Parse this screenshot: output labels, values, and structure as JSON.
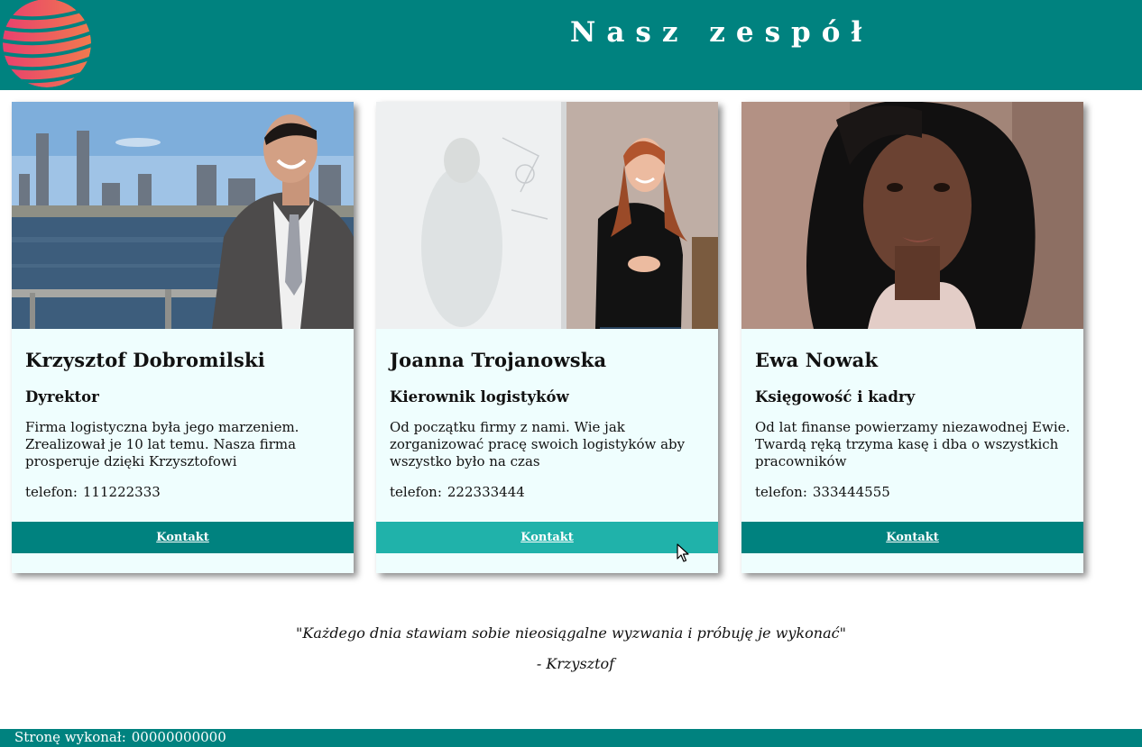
{
  "header": {
    "title": "Nasz zespół",
    "logo_icon": "globe-logo-icon",
    "background": "#00827f"
  },
  "team": [
    {
      "name": "Krzysztof Dobromilski",
      "role": "Dyrektor",
      "description": "Firma logistyczna była jego marzeniem. Zrealizował je 10 lat temu. Nasza firma prosperuje dzięki Krzysztofowi",
      "phone_label": "telefon:",
      "phone": "111222333",
      "button": "Kontakt",
      "photo": "man-in-suit-by-waterfront-photo"
    },
    {
      "name": "Joanna Trojanowska",
      "role": "Kierownik logistyków",
      "description": "Od początku firmy z nami. Wie jak zorganizować pracę swoich logistyków aby wszystko było na czas",
      "phone_label": "telefon:",
      "phone": "222333444",
      "button": "Kontakt",
      "photo": "woman-at-whiteboard-photo"
    },
    {
      "name": "Ewa Nowak",
      "role": "Księgowość i kadry",
      "description": "Od lat finanse powierzamy niezawodnej Ewie. Twardą ręką trzyma kasę i dba o wszystkich pracowników",
      "phone_label": "telefon:",
      "phone": "333444555",
      "button": "Kontakt",
      "photo": "woman-portrait-photo"
    }
  ],
  "quote": {
    "text": "\"Każdego dnia stawiam sobie nieosiągalne wyzwania i próbuję je wykonać\"",
    "author": "- Krzysztof"
  },
  "footer": {
    "label": "Stronę wykonał:",
    "value": "00000000000"
  },
  "colors": {
    "teal": "#00827f",
    "teal_hover": "#20b2aa",
    "card_bg": "#effefe"
  }
}
